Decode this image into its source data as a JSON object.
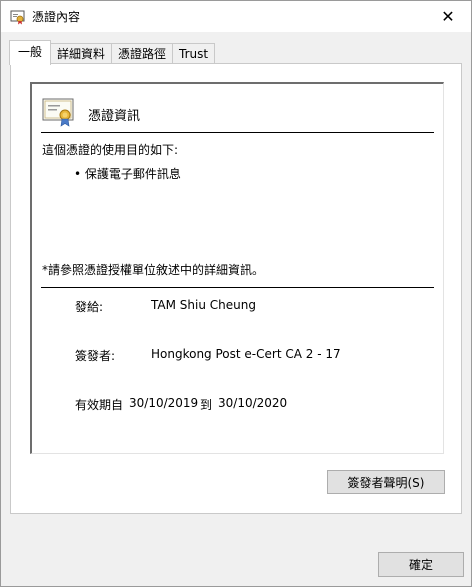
{
  "window": {
    "title": "憑證內容",
    "close_glyph": "✕"
  },
  "tabs": [
    {
      "label": "一般",
      "active": true
    },
    {
      "label": "詳細資料",
      "active": false
    },
    {
      "label": "憑證路徑",
      "active": false
    },
    {
      "label": "Trust",
      "active": false
    }
  ],
  "cert": {
    "heading": "憑證資訊",
    "purpose_title": "這個憑證的使用目的如下:",
    "purpose_items": [
      "• 保護電子郵件訊息"
    ],
    "reference_note": "*請參照憑證授權單位敘述中的詳細資訊。",
    "issued_to_label": "發給:",
    "issued_to_value": "TAM Shiu Cheung",
    "issued_by_label": "簽發者:",
    "issued_by_value": "Hongkong Post e-Cert CA 2 - 17",
    "validity_label": "有效期自",
    "valid_from": "30/10/2019",
    "validity_to_word": "到",
    "valid_to": "30/10/2020"
  },
  "buttons": {
    "issuer_statement": "簽發者聲明(S)",
    "ok": "確定"
  }
}
